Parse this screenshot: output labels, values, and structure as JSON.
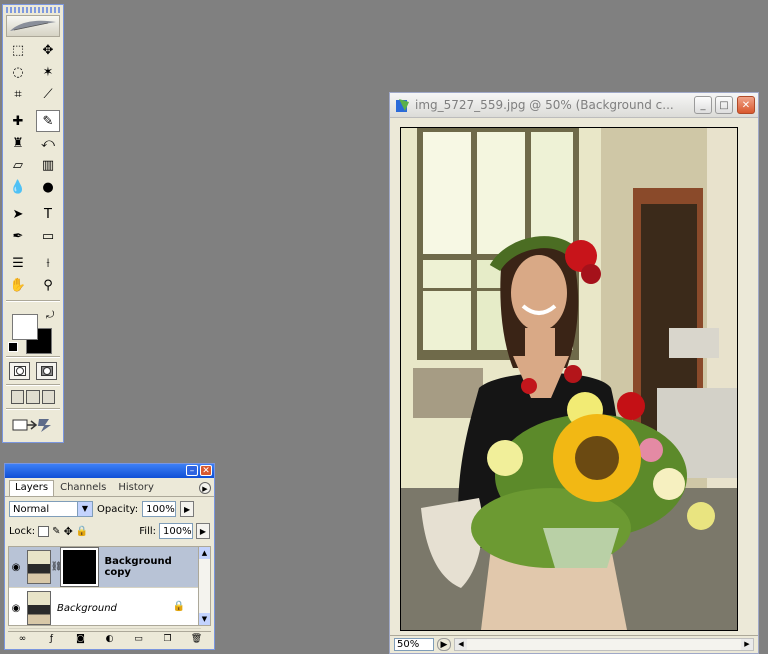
{
  "toolbox": {
    "tools": [
      {
        "name": "rect-marquee-icon",
        "glyph": "⬚"
      },
      {
        "name": "move-icon",
        "glyph": "✥"
      },
      {
        "name": "lasso-icon",
        "glyph": "◌"
      },
      {
        "name": "magic-wand-icon",
        "glyph": "✶"
      },
      {
        "name": "crop-icon",
        "glyph": "⌗"
      },
      {
        "name": "slice-icon",
        "glyph": "⟋"
      },
      {
        "name": "healing-brush-icon",
        "glyph": "✚"
      },
      {
        "name": "brush-icon",
        "glyph": "✎",
        "active": true
      },
      {
        "name": "clone-stamp-icon",
        "glyph": "♜"
      },
      {
        "name": "history-brush-icon",
        "glyph": "⤺"
      },
      {
        "name": "eraser-icon",
        "glyph": "▱"
      },
      {
        "name": "gradient-icon",
        "glyph": "▥"
      },
      {
        "name": "blur-icon",
        "glyph": "💧"
      },
      {
        "name": "dodge-icon",
        "glyph": "●"
      },
      {
        "name": "path-select-icon",
        "glyph": "➤"
      },
      {
        "name": "type-icon",
        "glyph": "T"
      },
      {
        "name": "pen-icon",
        "glyph": "✒"
      },
      {
        "name": "shape-icon",
        "glyph": "▭"
      },
      {
        "name": "notes-icon",
        "glyph": "☰"
      },
      {
        "name": "eyedropper-icon",
        "glyph": "⟊"
      },
      {
        "name": "hand-icon",
        "glyph": "✋"
      },
      {
        "name": "zoom-icon",
        "glyph": "⚲"
      }
    ],
    "foreground_color": "#ffffff",
    "background_color": "#000000"
  },
  "layers_panel": {
    "tabs": [
      "Layers",
      "Channels",
      "History"
    ],
    "active_tab": "Layers",
    "blend_mode": "Normal",
    "opacity_label": "Opacity:",
    "opacity_value": "100%",
    "lock_label": "Lock:",
    "fill_label": "Fill:",
    "fill_value": "100%",
    "layers": [
      {
        "name": "Background copy",
        "selected": true,
        "has_mask": true
      },
      {
        "name": "Background",
        "selected": false,
        "locked": true
      }
    ]
  },
  "document": {
    "title": "img_5727_559.jpg @ 50% (Background c...",
    "zoom": "50%"
  }
}
